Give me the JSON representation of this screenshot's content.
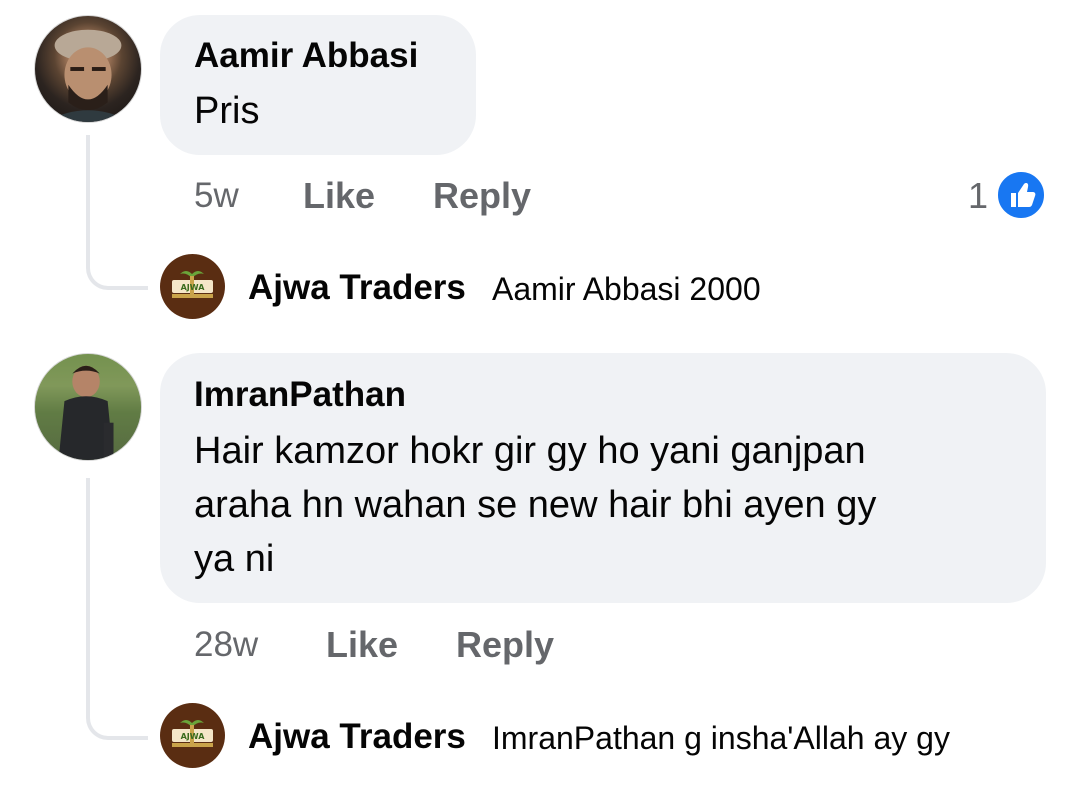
{
  "comments": [
    {
      "author": "Aamir Abbasi",
      "text": "Pris",
      "time": "5w",
      "like_label": "Like",
      "reply_label": "Reply",
      "reaction_count": "1",
      "reaction_icon": "thumbs-up-icon",
      "reply": {
        "author": "Ajwa Traders",
        "text": "Aamir Abbasi 2000"
      }
    },
    {
      "author": "ImranPathan",
      "text_lines": [
        "Hair kamzor hokr gir gy ho yani ganjpan",
        "araha hn wahan se new hair bhi ayen gy",
        "ya ni"
      ],
      "time": "28w",
      "like_label": "Like",
      "reply_label": "Reply",
      "reply": {
        "author": "Ajwa Traders",
        "text": "ImranPathan g insha'Allah ay gy"
      }
    }
  ],
  "brand_logo_text": "AJWA",
  "colors": {
    "bubble": "#f0f2f5",
    "meta": "#65676b",
    "text": "#050505",
    "like_blue": "#1877f2",
    "brand_brown": "#5a2d12"
  }
}
